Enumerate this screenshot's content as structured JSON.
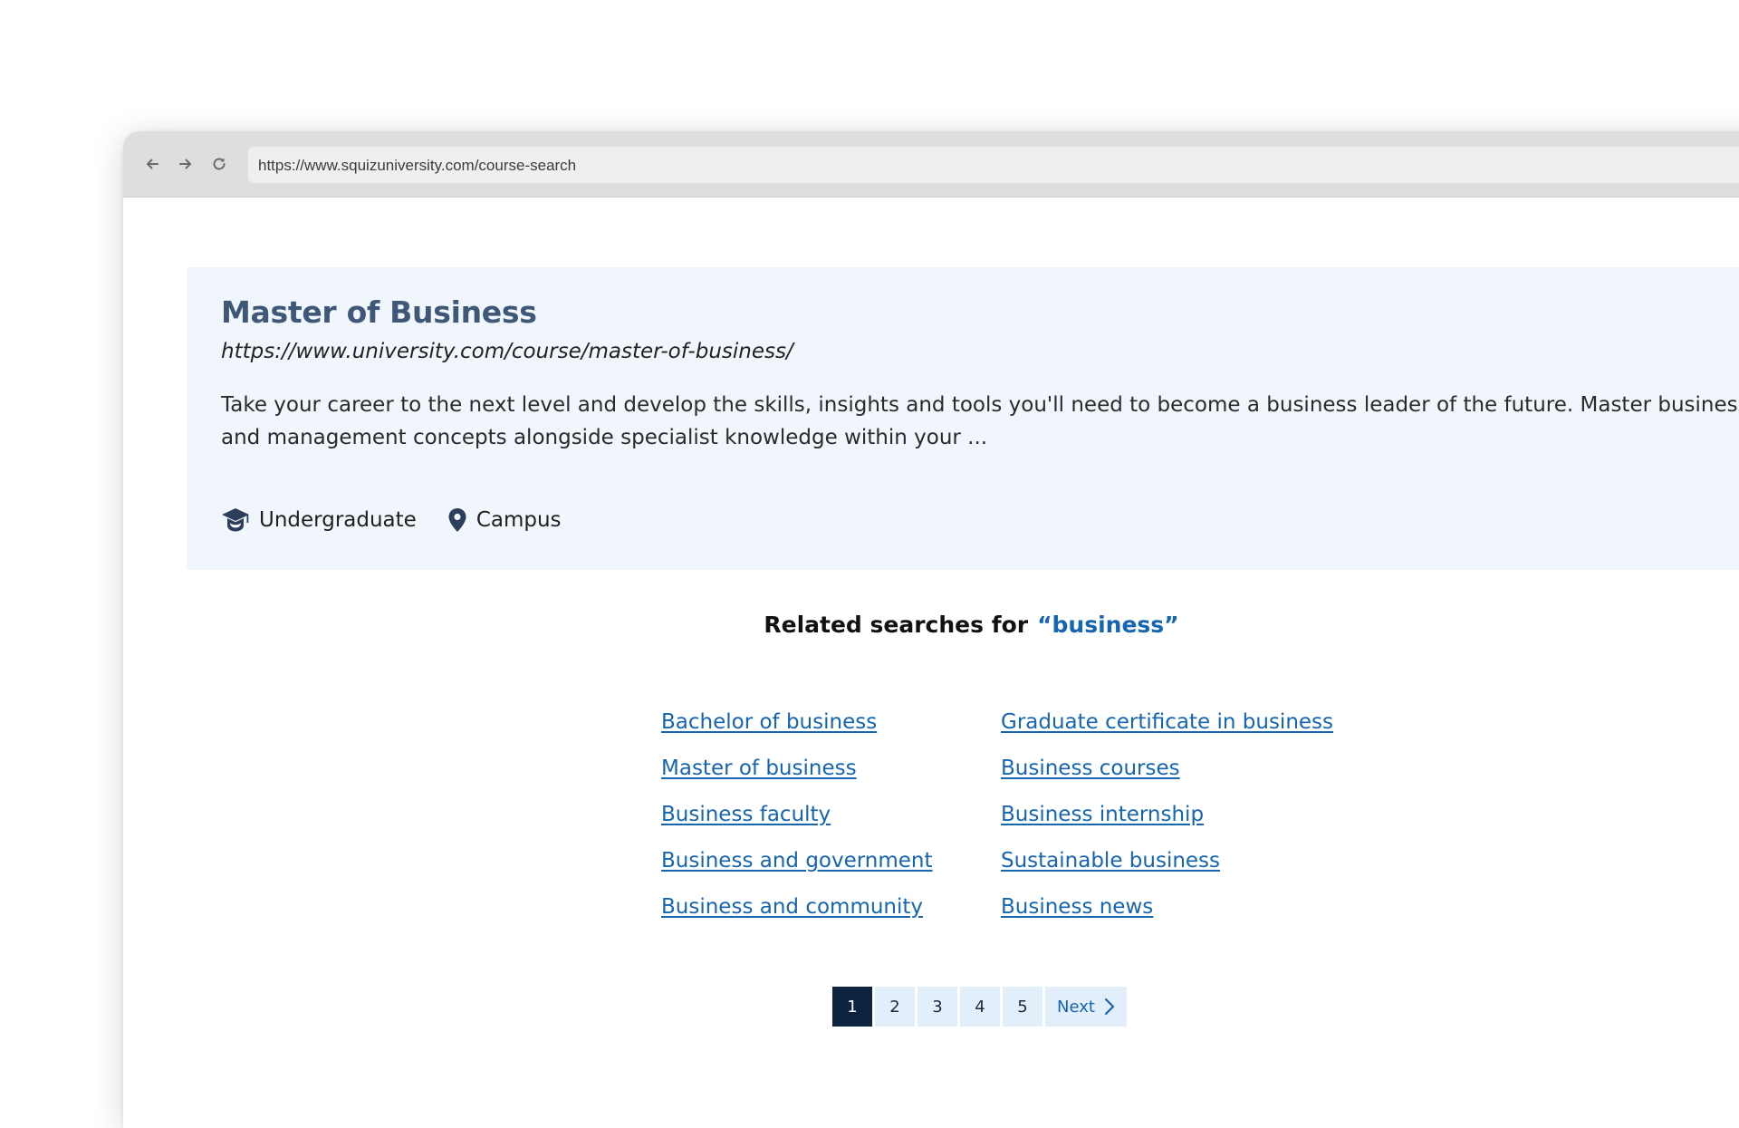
{
  "browser": {
    "url": "https://www.squizuniversity.com/course-search"
  },
  "result": {
    "title": "Master of Business",
    "url": "https://www.university.com/course/master-of-business/",
    "description": "Take your career to the next level and develop the skills, insights and tools you'll need to become a business leader of the future. Master business and management concepts alongside specialist knowledge within your ...",
    "meta": {
      "level": "Undergraduate",
      "level_icon": "graduation-cap-icon",
      "location": "Campus",
      "location_icon": "map-pin-icon"
    }
  },
  "related": {
    "heading": "Related searches for",
    "term": "“business”",
    "left_links": [
      "Bachelor of business",
      "Master of business",
      "Business faculty",
      "Business and government",
      "Business and community"
    ],
    "right_links": [
      "Graduate certificate in business",
      "Business courses",
      "Business internship",
      "Sustainable business",
      "Business news"
    ]
  },
  "pagination": {
    "pages": [
      "1",
      "2",
      "3",
      "4",
      "5"
    ],
    "current": "1",
    "next_label": "Next"
  },
  "colors": {
    "accent": "#1565b0",
    "title": "#3f5878",
    "card_bg": "#f1f6fc",
    "active_page": "#0d2440"
  }
}
